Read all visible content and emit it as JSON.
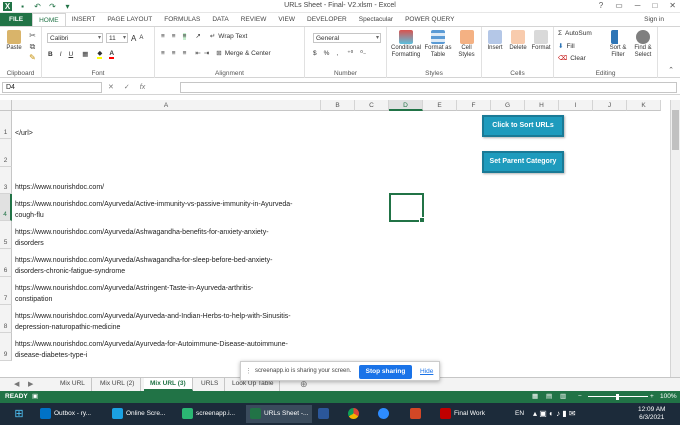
{
  "window": {
    "title": "URLs Sheet - Final- V2.xlsm - Excel",
    "signin": "Sign in",
    "help": "?"
  },
  "ribbon_tabs": [
    "FILE",
    "HOME",
    "INSERT",
    "PAGE LAYOUT",
    "FORMULAS",
    "DATA",
    "REVIEW",
    "VIEW",
    "DEVELOPER",
    "Spectacular",
    "POWER QUERY"
  ],
  "clipboard": {
    "paste": "Paste",
    "label": "Clipboard"
  },
  "font": {
    "name": "Calibri",
    "size": "11",
    "bold": "B",
    "italic": "I",
    "underline": "U",
    "grow": "A",
    "shrink": "A",
    "fontcolor": "A",
    "label": "Font"
  },
  "alignment": {
    "wrap": "Wrap Text",
    "merge": "Merge & Center",
    "label": "Alignment"
  },
  "number": {
    "format": "General",
    "currency": "$",
    "percent": "%",
    "comma": ",",
    "label": "Number"
  },
  "styles": {
    "cond": "Conditional Formatting",
    "fmt_table": "Format as Table",
    "cell_styles": "Cell Styles",
    "label": "Styles"
  },
  "cells": {
    "insert": "Insert",
    "delete": "Delete",
    "format": "Format",
    "label": "Cells"
  },
  "editing": {
    "autosum": "AutoSum",
    "fill": "Fill",
    "clear": "Clear",
    "sort": "Sort & Filter",
    "find": "Find & Select",
    "label": "Editing"
  },
  "formula_bar": {
    "namebox": "D4",
    "cancel": "✕",
    "enter": "✓",
    "fx": "fx",
    "value": ""
  },
  "columns": [
    "A",
    "B",
    "C",
    "D",
    "E",
    "F",
    "G",
    "H",
    "I",
    "J",
    "K"
  ],
  "rows": [
    {
      "num": "1",
      "text1": "</url>",
      "text2": ""
    },
    {
      "num": "2",
      "text1": "",
      "text2": ""
    },
    {
      "num": "3",
      "text1": "https://www.nourishdoc.com/",
      "text2": ""
    },
    {
      "num": "4",
      "text1": "https://www.nourishdoc.com/Ayurveda/Active-immunity-vs-passive-immunity-in-Ayurveda-",
      "text2": "cough-flu"
    },
    {
      "num": "5",
      "text1": "https://www.nourishdoc.com/Ayurveda/Ashwagandha-benefits-for-anxiety-anxiety-",
      "text2": "disorders"
    },
    {
      "num": "6",
      "text1": "https://www.nourishdoc.com/Ayurveda/Ashwagandha-for-sleep-before-bed-anxiety-",
      "text2": "disorders-chronic-fatigue-syndrome"
    },
    {
      "num": "7",
      "text1": "https://www.nourishdoc.com/Ayurveda/Astringent-Taste-in-Ayurveda-arthritis-",
      "text2": "constipation"
    },
    {
      "num": "8",
      "text1": "https://www.nourishdoc.com/Ayurveda/Ayurveda-and-Indian-Herbs-to-help-with-Sinusitis-",
      "text2": "depression-naturopathic-medicine"
    },
    {
      "num": "9",
      "text1": "https://www.nourishdoc.com/Ayurveda/Ayurveda-for-Autoimmune-Disease-autoimmune-",
      "text2": "disease-diabetes-type-i"
    }
  ],
  "macros": {
    "sort_urls": "Click to Sort URLs",
    "set_parent": "Set Parent Category"
  },
  "sheet_tabs": [
    "Mix URL",
    "Mix URL (2)",
    "Mix URL (3)",
    "URLS",
    "Look Up Table"
  ],
  "active_sheet": "Mix URL (3)",
  "status": {
    "ready": "READY",
    "zoom": "100%"
  },
  "share": {
    "msg": "screenapp.io is sharing your screen.",
    "stop": "Stop sharing",
    "hide": "Hide"
  },
  "taskbar": {
    "items": [
      "Outbox - ry...",
      "Online Scre...",
      "screenapp.i...",
      "URLs Sheet -...",
      "Final Work"
    ],
    "lang": "EN",
    "time": "12:09 AM",
    "date": "6/3/2021"
  },
  "colors": {
    "excel_green": "#217346",
    "macro_blue": "#1e9bbd",
    "taskbar": "#1c2b3a"
  }
}
